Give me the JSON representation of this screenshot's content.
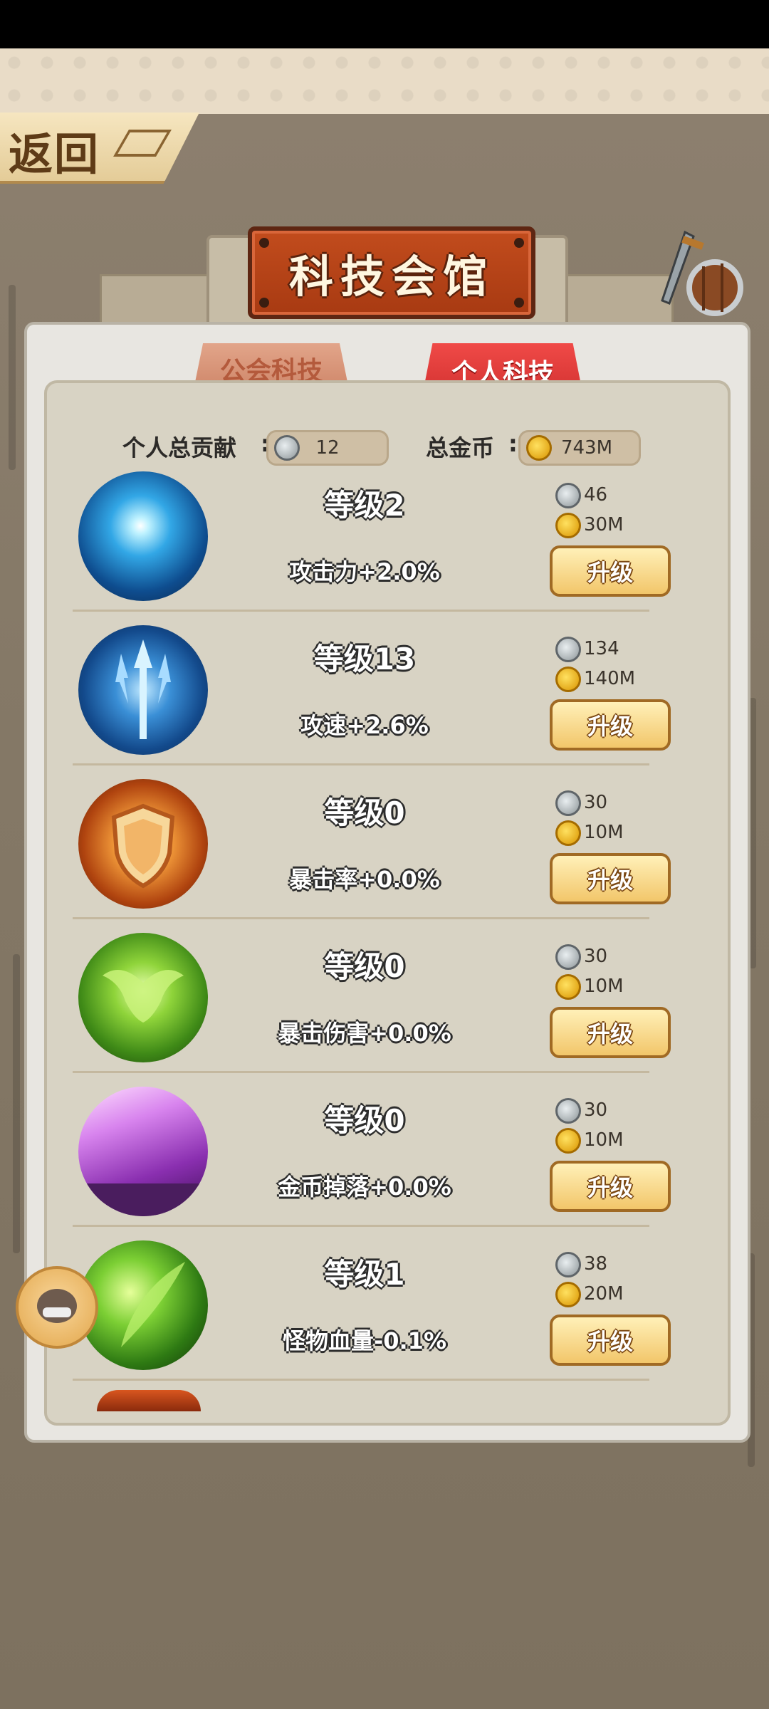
{
  "header": {
    "back_label": "返回",
    "title": "科技会馆"
  },
  "tabs": [
    {
      "label": "公会科技",
      "active": false
    },
    {
      "label": "个人科技",
      "active": true
    }
  ],
  "stats": {
    "contribution_label": "个人总贡献",
    "contribution_value": "12",
    "gold_label": "总金币",
    "gold_value": "743M"
  },
  "techs": [
    {
      "level": "等级2",
      "effect": "攻击力+2.0%",
      "cost_silver": "46",
      "cost_gold": "30M",
      "upgrade_label": "升级",
      "icon": "frost-burst-icon"
    },
    {
      "level": "等级13",
      "effect": "攻速+2.6%",
      "cost_silver": "134",
      "cost_gold": "140M",
      "upgrade_label": "升级",
      "icon": "trident-icon"
    },
    {
      "level": "等级0",
      "effect": "暴击率+0.0%",
      "cost_silver": "30",
      "cost_gold": "10M",
      "upgrade_label": "升级",
      "icon": "shield-icon"
    },
    {
      "level": "等级0",
      "effect": "暴击伤害+0.0%",
      "cost_silver": "30",
      "cost_gold": "10M",
      "upgrade_label": "升级",
      "icon": "green-eagle-icon"
    },
    {
      "level": "等级0",
      "effect": "金币掉落+0.0%",
      "cost_silver": "30",
      "cost_gold": "10M",
      "upgrade_label": "升级",
      "icon": "purple-light-icon"
    },
    {
      "level": "等级1",
      "effect": "怪物血量-0.1%",
      "cost_silver": "38",
      "cost_gold": "20M",
      "upgrade_label": "升级",
      "icon": "green-leaf-icon"
    }
  ],
  "colors": {
    "accent_red": "#c92a2a",
    "button_gold": "#f2c66a",
    "panel": "#e8e6e1"
  }
}
